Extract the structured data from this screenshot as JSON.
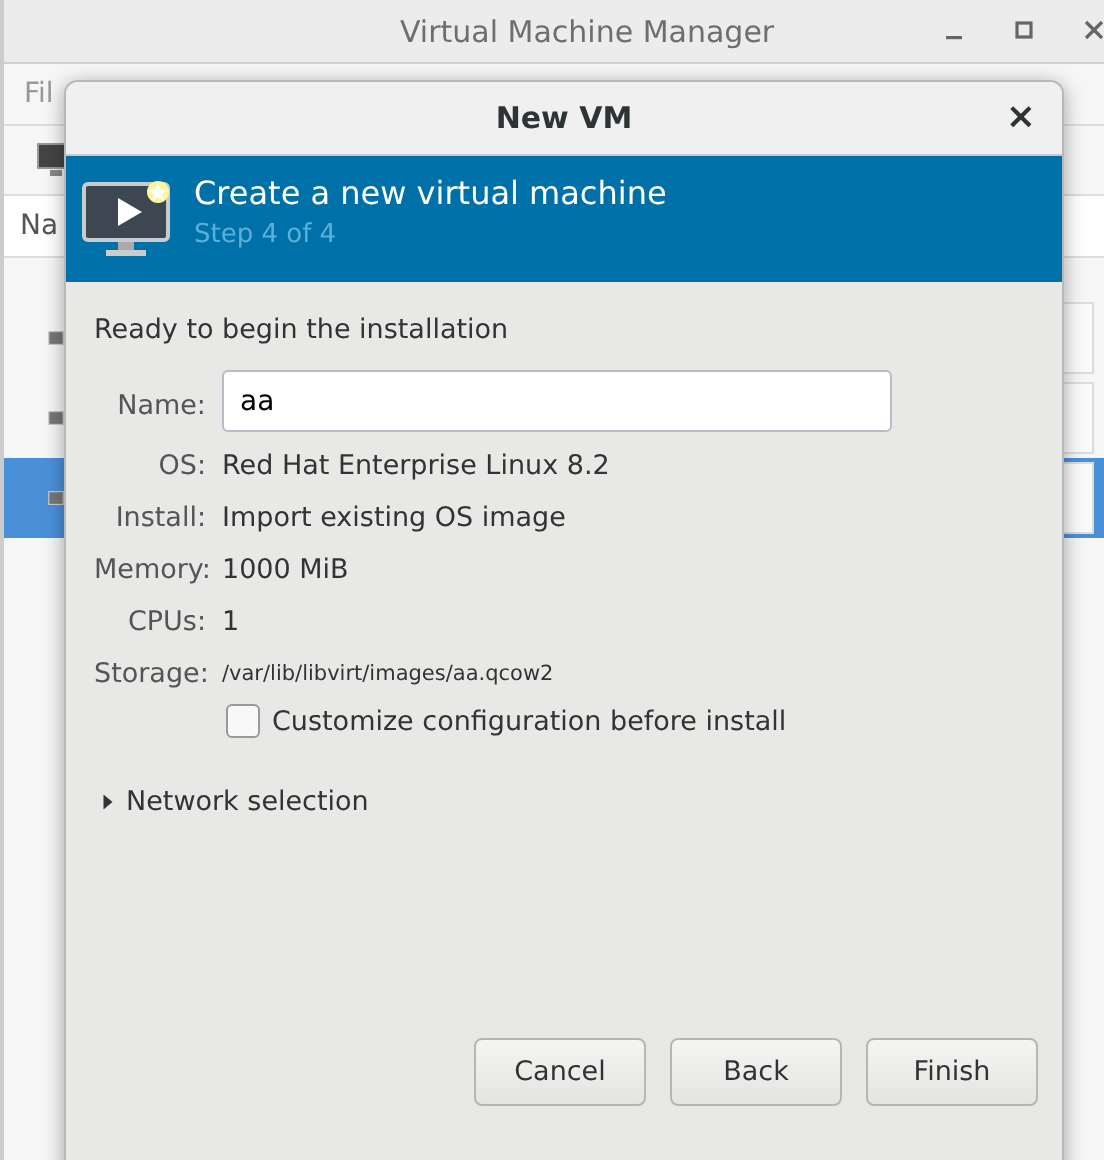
{
  "background_window": {
    "title": "Virtual Machine Manager",
    "menu": [
      "Fil"
    ],
    "column": "Na",
    "rows": [
      {
        "selected": false
      },
      {
        "selected": false
      },
      {
        "selected": true
      }
    ]
  },
  "dialog": {
    "title": "New VM",
    "close": "×",
    "banner": {
      "title": "Create a new virtual machine",
      "subtitle": "Step 4 of 4"
    },
    "heading": "Ready to begin the installation",
    "name": {
      "label": "Name:",
      "value": "aa"
    },
    "details": [
      {
        "label": "OS:",
        "value": "Red Hat Enterprise Linux 8.2",
        "kind": "normal"
      },
      {
        "label": "Install:",
        "value": "Import existing OS image",
        "kind": "normal"
      },
      {
        "label": "Memory:",
        "value": "1000 MiB",
        "kind": "normal"
      },
      {
        "label": "CPUs:",
        "value": "1",
        "kind": "normal"
      },
      {
        "label": "Storage:",
        "value": "/var/lib/libvirt/images/aa.qcow2",
        "kind": "small"
      }
    ],
    "customize": {
      "label": "Customize configuration before install",
      "checked": false
    },
    "network": {
      "label": "Network selection",
      "expanded": false
    },
    "buttons": [
      "Cancel",
      "Back",
      "Finish"
    ]
  }
}
